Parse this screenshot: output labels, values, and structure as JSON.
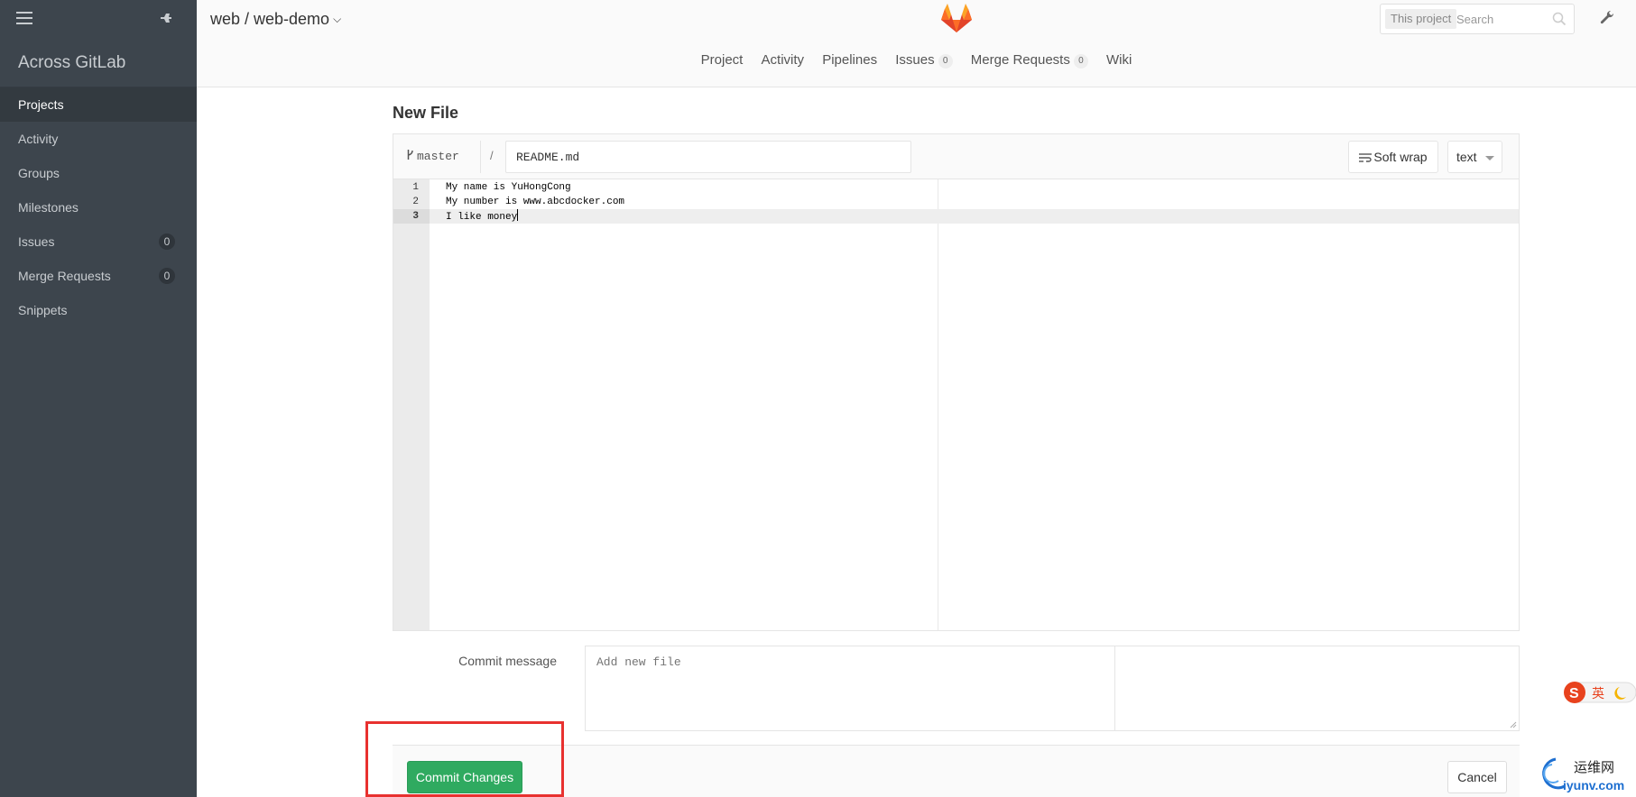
{
  "sidebar": {
    "title": "Across GitLab",
    "items": [
      {
        "label": "Projects",
        "active": true
      },
      {
        "label": "Activity"
      },
      {
        "label": "Groups"
      },
      {
        "label": "Milestones"
      },
      {
        "label": "Issues",
        "count": "0"
      },
      {
        "label": "Merge Requests",
        "count": "0"
      },
      {
        "label": "Snippets"
      }
    ]
  },
  "header": {
    "breadcrumb": "web / web-demo",
    "search": {
      "scope": "This project",
      "placeholder": "Search"
    },
    "nav": [
      {
        "label": "Project"
      },
      {
        "label": "Activity"
      },
      {
        "label": "Pipelines"
      },
      {
        "label": "Issues",
        "count": "0"
      },
      {
        "label": "Merge Requests",
        "count": "0"
      },
      {
        "label": "Wiki"
      }
    ]
  },
  "page": {
    "title": "New File"
  },
  "editor": {
    "branch": "master",
    "separator": "/",
    "filename": "README.md",
    "soft_wrap_label": "Soft wrap",
    "language": "text",
    "lines": [
      {
        "number": "1",
        "text": "My name is YuHongCong"
      },
      {
        "number": "2",
        "text": "My number is www.abcdocker.com"
      },
      {
        "number": "3",
        "text": "I like money"
      }
    ]
  },
  "commit": {
    "label": "Commit message",
    "placeholder": "Add new file",
    "commit_button": "Commit Changes",
    "cancel_button": "Cancel"
  },
  "overlay": {
    "ime_label": "英",
    "watermark_text": "运维网",
    "watermark_url": "iyunv.com"
  },
  "colors": {
    "sidebar_bg": "#3d454d",
    "commit_button": "#2faa60",
    "highlight_box": "#e8312f"
  }
}
